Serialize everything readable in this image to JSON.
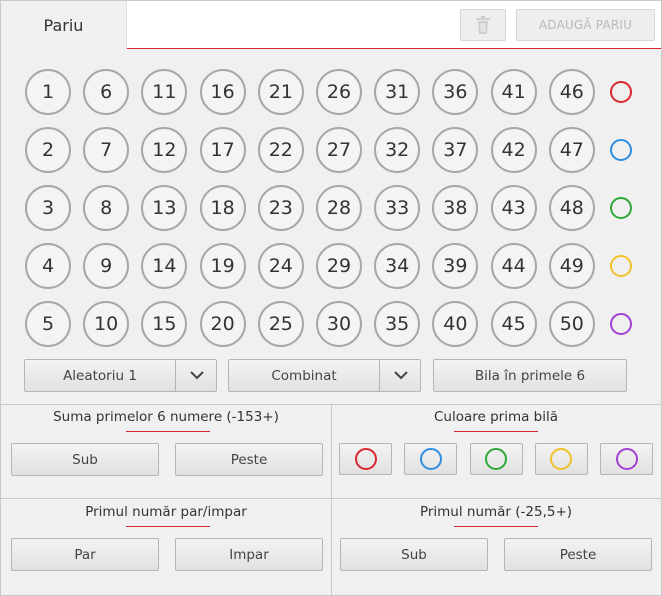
{
  "header": {
    "tab_label": "Pariu",
    "add_bet_label": "ADAUGĂ PARIU",
    "trash_icon": "trash-icon"
  },
  "grid": {
    "columns": [
      [
        1,
        2,
        3,
        4,
        5
      ],
      [
        6,
        7,
        8,
        9,
        10
      ],
      [
        11,
        12,
        13,
        14,
        15
      ],
      [
        16,
        17,
        18,
        19,
        20
      ],
      [
        21,
        22,
        23,
        24,
        25
      ],
      [
        26,
        27,
        28,
        29,
        30
      ],
      [
        31,
        32,
        33,
        34,
        35
      ],
      [
        36,
        37,
        38,
        39,
        40
      ],
      [
        41,
        42,
        43,
        44,
        45
      ],
      [
        46,
        47,
        48,
        49,
        50
      ]
    ],
    "row_colors": [
      {
        "name": "red",
        "hex": "#d9272e"
      },
      {
        "name": "blue",
        "hex": "#2f8ee0"
      },
      {
        "name": "green",
        "hex": "#2fa83a"
      },
      {
        "name": "yellow",
        "hex": "#f0c22a"
      },
      {
        "name": "purple",
        "hex": "#a23fd6"
      }
    ]
  },
  "controls": {
    "random_label": "Aleatoriu 1",
    "combined_label": "Combinat",
    "ball_in_first_label": "Bila în primele 6"
  },
  "sections": {
    "sum_first_six": {
      "title": "Suma primelor 6 numere (-153+)",
      "under_label": "Sub",
      "over_label": "Peste"
    },
    "first_ball_color": {
      "title": "Culoare prima bilă"
    },
    "first_number_parity": {
      "title": "Primul număr par/impar",
      "even_label": "Par",
      "odd_label": "Impar"
    },
    "first_number_value": {
      "title": "Primul număr (-25,5+)",
      "under_label": "Sub",
      "over_label": "Peste"
    }
  },
  "colors": {
    "accent_red": "#d9272e",
    "ball_border": "#a7a7a7",
    "panel_bg": "#f0f0f0"
  }
}
